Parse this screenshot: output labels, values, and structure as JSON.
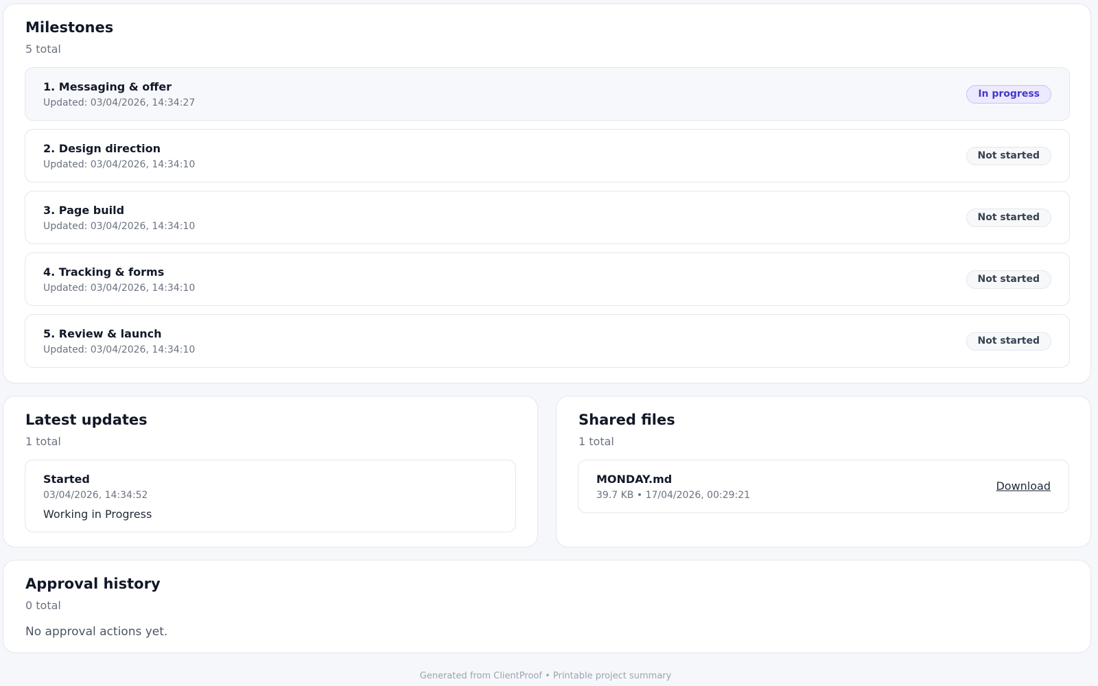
{
  "milestones": {
    "title": "Milestones",
    "count": "5 total",
    "items": [
      {
        "title": "1. Messaging & offer",
        "updated": "Updated: 03/04/2026, 14:34:27",
        "status": "In progress"
      },
      {
        "title": "2. Design direction",
        "updated": "Updated: 03/04/2026, 14:34:10",
        "status": "Not started"
      },
      {
        "title": "3. Page build",
        "updated": "Updated: 03/04/2026, 14:34:10",
        "status": "Not started"
      },
      {
        "title": "4. Tracking & forms",
        "updated": "Updated: 03/04/2026, 14:34:10",
        "status": "Not started"
      },
      {
        "title": "5. Review & launch",
        "updated": "Updated: 03/04/2026, 14:34:10",
        "status": "Not started"
      }
    ]
  },
  "updates": {
    "title": "Latest updates",
    "count": "1 total",
    "items": [
      {
        "title": "Started",
        "time": "03/04/2026, 14:34:52",
        "body": "Working in Progress"
      }
    ]
  },
  "files": {
    "title": "Shared files",
    "count": "1 total",
    "items": [
      {
        "name": "MONDAY.md",
        "meta": "39.7 KB • 17/04/2026, 00:29:21",
        "action": "Download"
      }
    ]
  },
  "approvals": {
    "title": "Approval history",
    "count": "0 total",
    "empty": "No approval actions yet."
  },
  "footer": "Generated from ClientProof • Printable project summary",
  "colors": {
    "badge_in_progress_bg": "#ede9fe",
    "badge_in_progress_text": "#4338ca",
    "badge_not_started_bg": "#f7f8fa",
    "page_bg": "#f6f7fa"
  }
}
